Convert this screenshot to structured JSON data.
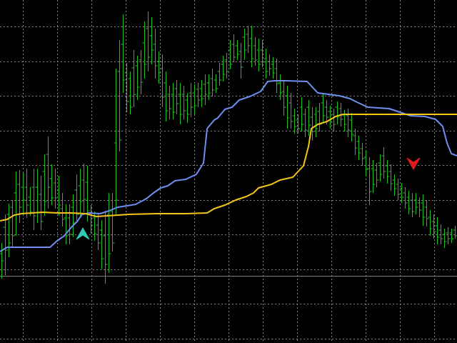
{
  "colors": {
    "background": "#000000",
    "grid": "#9a9a9a",
    "bars": "#1fbf1f",
    "fast_line": "#f5c518",
    "slow_line": "#6f8ff0",
    "buy_arrow": "#33c7b5",
    "sell_arrow": "#e21b1b",
    "baseline": "#9a9a9a"
  },
  "chart_data": {
    "type": "ohlc",
    "grid": true,
    "ylim": [
      -20,
      470
    ],
    "xlim": [
      0,
      640
    ],
    "baseline_level": 76,
    "bars": [
      [
        2,
        340,
        390,
        355,
        365
      ],
      [
        7,
        300,
        385,
        318,
        350
      ],
      [
        12,
        285,
        360,
        300,
        340
      ],
      [
        17,
        280,
        345,
        290,
        330
      ],
      [
        22,
        240,
        330,
        270,
        300
      ],
      [
        27,
        238,
        312,
        258,
        290
      ],
      [
        32,
        242,
        300,
        262,
        280
      ],
      [
        37,
        236,
        305,
        262,
        287
      ],
      [
        42,
        262,
        302,
        276,
        296
      ],
      [
        47,
        236,
        322,
        262,
        302
      ],
      [
        52,
        236,
        312,
        262,
        298
      ],
      [
        57,
        246,
        322,
        272,
        310
      ],
      [
        62,
        216,
        302,
        240,
        282
      ],
      [
        67,
        191,
        292,
        216,
        262
      ],
      [
        72,
        230,
        287,
        250,
        277
      ],
      [
        77,
        236,
        292,
        256,
        277
      ],
      [
        82,
        246,
        302,
        266,
        287
      ],
      [
        87,
        270,
        317,
        292,
        307
      ],
      [
        92,
        286,
        342,
        305,
        330
      ],
      [
        97,
        286,
        342,
        305,
        328
      ],
      [
        102,
        272,
        332,
        290,
        312
      ],
      [
        107,
        244,
        312,
        266,
        300
      ],
      [
        112,
        236,
        302,
        260,
        282
      ],
      [
        117,
        229,
        297,
        252,
        279
      ],
      [
        122,
        232,
        310,
        255,
        295
      ],
      [
        127,
        287,
        327,
        300,
        315
      ],
      [
        132,
        296,
        337,
        305,
        327
      ],
      [
        137,
        300,
        350,
        315,
        340
      ],
      [
        142,
        308,
        377,
        322,
        362
      ],
      [
        147,
        295,
        397,
        330,
        370
      ],
      [
        152,
        270,
        382,
        300,
        355
      ],
      [
        157,
        270,
        352,
        296,
        340
      ],
      [
        162,
        96,
        302,
        200,
        280
      ],
      [
        167,
        56,
        212,
        100,
        196
      ],
      [
        172,
        20,
        130,
        62,
        112
      ],
      [
        177,
        88,
        157,
        102,
        142
      ],
      [
        182,
        100,
        160,
        110,
        150
      ],
      [
        187,
        70,
        150,
        95,
        132
      ],
      [
        192,
        78,
        140,
        92,
        122
      ],
      [
        197,
        70,
        132,
        84,
        115
      ],
      [
        202,
        30,
        110,
        60,
        90
      ],
      [
        207,
        16,
        100,
        40,
        80
      ],
      [
        212,
        24,
        90,
        50,
        70
      ],
      [
        217,
        40,
        110,
        62,
        92
      ],
      [
        222,
        72,
        117,
        86,
        102
      ],
      [
        227,
        76,
        150,
        96,
        136
      ],
      [
        232,
        100,
        170,
        116,
        155
      ],
      [
        237,
        120,
        167,
        132,
        152
      ],
      [
        242,
        116,
        167,
        132,
        157
      ],
      [
        247,
        112,
        160,
        124,
        145
      ],
      [
        252,
        116,
        174,
        132,
        160
      ],
      [
        257,
        120,
        167,
        132,
        155
      ],
      [
        262,
        130,
        172,
        140,
        160
      ],
      [
        267,
        116,
        164,
        130,
        150
      ],
      [
        272,
        118,
        160,
        130,
        148
      ],
      [
        277,
        116,
        150,
        125,
        140
      ],
      [
        282,
        112,
        150,
        124,
        138
      ],
      [
        287,
        104,
        147,
        118,
        132
      ],
      [
        292,
        104,
        140,
        116,
        130
      ],
      [
        297,
        96,
        135,
        110,
        126
      ],
      [
        302,
        104,
        130,
        112,
        124
      ],
      [
        307,
        88,
        120,
        100,
        112
      ],
      [
        312,
        78,
        114,
        90,
        104
      ],
      [
        317,
        74,
        110,
        84,
        100
      ],
      [
        322,
        56,
        97,
        70,
        90
      ],
      [
        327,
        48,
        87,
        62,
        80
      ],
      [
        332,
        56,
        84,
        64,
        76
      ],
      [
        337,
        60,
        110,
        72,
        94
      ],
      [
        342,
        40,
        84,
        52,
        70
      ],
      [
        347,
        36,
        74,
        48,
        64
      ],
      [
        352,
        36,
        94,
        54,
        82
      ],
      [
        357,
        52,
        92,
        64,
        84
      ],
      [
        362,
        54,
        100,
        70,
        90
      ],
      [
        367,
        56,
        94,
        70,
        87
      ],
      [
        372,
        68,
        110,
        82,
        100
      ],
      [
        377,
        76,
        106,
        86,
        96
      ],
      [
        382,
        80,
        110,
        90,
        102
      ],
      [
        387,
        82,
        130,
        96,
        117
      ],
      [
        392,
        104,
        140,
        116,
        130
      ],
      [
        397,
        112,
        162,
        128,
        150
      ],
      [
        402,
        120,
        180,
        134,
        165
      ],
      [
        407,
        130,
        180,
        144,
        170
      ],
      [
        412,
        152,
        187,
        162,
        177
      ],
      [
        417,
        160,
        187,
        168,
        180
      ],
      [
        422,
        136,
        184,
        150,
        174
      ],
      [
        427,
        152,
        192,
        160,
        182
      ],
      [
        432,
        140,
        190,
        150,
        175
      ],
      [
        437,
        150,
        197,
        164,
        184
      ],
      [
        442,
        150,
        192,
        160,
        180
      ],
      [
        447,
        144,
        184,
        156,
        174
      ],
      [
        452,
        132,
        172,
        144,
        162
      ],
      [
        457,
        140,
        174,
        150,
        164
      ],
      [
        462,
        148,
        180,
        156,
        170
      ],
      [
        467,
        152,
        184,
        160,
        174
      ],
      [
        472,
        142,
        174,
        150,
        164
      ],
      [
        477,
        144,
        177,
        152,
        167
      ],
      [
        482,
        154,
        184,
        162,
        174
      ],
      [
        487,
        152,
        192,
        162,
        182
      ],
      [
        492,
        158,
        198,
        168,
        188
      ],
      [
        497,
        180,
        217,
        190,
        207
      ],
      [
        502,
        190,
        224,
        198,
        214
      ],
      [
        507,
        200,
        232,
        208,
        222
      ],
      [
        512,
        210,
        247,
        220,
        237
      ],
      [
        517,
        220,
        287,
        236,
        268
      ],
      [
        522,
        224,
        270,
        236,
        258
      ],
      [
        527,
        228,
        262,
        238,
        252
      ],
      [
        532,
        216,
        254,
        228,
        244
      ],
      [
        537,
        206,
        250,
        218,
        240
      ],
      [
        542,
        224,
        257,
        232,
        247
      ],
      [
        547,
        230,
        267,
        240,
        257
      ],
      [
        552,
        244,
        274,
        252,
        264
      ],
      [
        557,
        250,
        280,
        258,
        272
      ],
      [
        562,
        256,
        284,
        264,
        276
      ],
      [
        567,
        262,
        292,
        270,
        284
      ],
      [
        572,
        267,
        300,
        276,
        292
      ],
      [
        577,
        270,
        304,
        280,
        296
      ],
      [
        582,
        270,
        300,
        280,
        290
      ],
      [
        587,
        276,
        304,
        284,
        294
      ],
      [
        592,
        272,
        316,
        284,
        304
      ],
      [
        597,
        280,
        317,
        290,
        306
      ],
      [
        602,
        294,
        330,
        304,
        320
      ],
      [
        607,
        300,
        334,
        310,
        324
      ],
      [
        612,
        304,
        342,
        316,
        332
      ],
      [
        617,
        314,
        342,
        322,
        334
      ],
      [
        622,
        320,
        347,
        328,
        338
      ],
      [
        627,
        318,
        342,
        326,
        334
      ],
      [
        632,
        320,
        340,
        326,
        334
      ],
      [
        637,
        316,
        334,
        322,
        330
      ]
    ],
    "fast_line": [
      [
        0,
        309
      ],
      [
        10,
        307
      ],
      [
        20,
        301
      ],
      [
        30,
        299
      ],
      [
        45,
        298
      ],
      [
        60,
        297
      ],
      [
        80,
        298
      ],
      [
        100,
        298
      ],
      [
        120,
        299
      ],
      [
        135,
        303
      ],
      [
        165,
        301
      ],
      [
        180,
        300
      ],
      [
        220,
        299
      ],
      [
        260,
        299
      ],
      [
        290,
        298
      ],
      [
        300,
        292
      ],
      [
        315,
        287
      ],
      [
        330,
        280
      ],
      [
        345,
        275
      ],
      [
        355,
        270
      ],
      [
        362,
        263
      ],
      [
        380,
        258
      ],
      [
        392,
        252
      ],
      [
        410,
        248
      ],
      [
        425,
        232
      ],
      [
        432,
        205
      ],
      [
        436,
        180
      ],
      [
        445,
        174
      ],
      [
        458,
        170
      ],
      [
        470,
        163
      ],
      [
        480,
        160
      ],
      [
        520,
        160
      ],
      [
        560,
        160
      ],
      [
        600,
        160
      ],
      [
        640,
        160
      ]
    ],
    "slow_line": [
      [
        0,
        352
      ],
      [
        10,
        346
      ],
      [
        40,
        346
      ],
      [
        70,
        346
      ],
      [
        80,
        337
      ],
      [
        90,
        330
      ],
      [
        100,
        318
      ],
      [
        108,
        310
      ],
      [
        115,
        300
      ],
      [
        125,
        298
      ],
      [
        140,
        299
      ],
      [
        150,
        296
      ],
      [
        165,
        290
      ],
      [
        190,
        286
      ],
      [
        205,
        278
      ],
      [
        215,
        270
      ],
      [
        225,
        263
      ],
      [
        235,
        260
      ],
      [
        245,
        253
      ],
      [
        260,
        251
      ],
      [
        275,
        244
      ],
      [
        285,
        228
      ],
      [
        290,
        180
      ],
      [
        300,
        168
      ],
      [
        305,
        165
      ],
      [
        315,
        153
      ],
      [
        325,
        150
      ],
      [
        335,
        140
      ],
      [
        350,
        135
      ],
      [
        365,
        128
      ],
      [
        375,
        114
      ],
      [
        385,
        113
      ],
      [
        400,
        113
      ],
      [
        430,
        114
      ],
      [
        445,
        130
      ],
      [
        460,
        132
      ],
      [
        475,
        134
      ],
      [
        490,
        138
      ],
      [
        500,
        143
      ],
      [
        515,
        150
      ],
      [
        545,
        152
      ],
      [
        560,
        157
      ],
      [
        575,
        162
      ],
      [
        595,
        163
      ],
      [
        610,
        167
      ],
      [
        620,
        177
      ],
      [
        626,
        200
      ],
      [
        632,
        215
      ],
      [
        640,
        218
      ]
    ],
    "arrows": [
      {
        "type": "buy",
        "x": 116,
        "y": 326
      },
      {
        "type": "sell",
        "x": 579,
        "y": 228
      }
    ]
  }
}
